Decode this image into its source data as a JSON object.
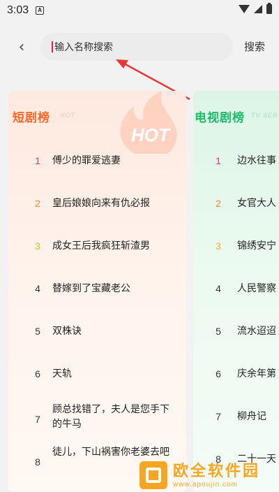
{
  "status_bar": {
    "time": "3:03",
    "notification_icon": "A"
  },
  "header": {
    "back_icon": "chevron-left-icon",
    "back_glyph": "‹",
    "search_placeholder": "输入名称搜索",
    "search_label": "搜索"
  },
  "colors": {
    "short_accent": "#ff6a2a",
    "tv_accent": "#1ebc6a",
    "rank_top1": "#e8307a",
    "rank_top2": "#f08a24",
    "rank_top3": "#f0b424",
    "rank_default": "#333333",
    "arrow": "#e53935"
  },
  "short_card": {
    "title": "短剧榜",
    "subtitle": "HOT",
    "badge_text": "HOT",
    "items": [
      {
        "rank": "1",
        "title": "傅少的罪爱逃妻"
      },
      {
        "rank": "2",
        "title": "皇后娘娘向来有仇必报"
      },
      {
        "rank": "3",
        "title": "成女王后我疯狂斩渣男"
      },
      {
        "rank": "4",
        "title": "替嫁到了宝藏老公"
      },
      {
        "rank": "5",
        "title": "双株诀"
      },
      {
        "rank": "6",
        "title": "天轨"
      },
      {
        "rank": "7",
        "title": "顾总找错了，夫人是您手下的牛马"
      },
      {
        "rank": "8",
        "title": "徒儿，下山祸害你老婆去吧"
      }
    ]
  },
  "tv_card": {
    "title": "电视剧榜",
    "subtitle": "TV SER",
    "items": [
      {
        "rank": "1",
        "title": "边水往事"
      },
      {
        "rank": "2",
        "title": "女官大人"
      },
      {
        "rank": "3",
        "title": "锦绣安宁"
      },
      {
        "rank": "4",
        "title": "人民警察"
      },
      {
        "rank": "5",
        "title": "流水迢迢"
      },
      {
        "rank": "6",
        "title": "庆余年第"
      },
      {
        "rank": "7",
        "title": "柳舟记"
      },
      {
        "rank": "8",
        "title": "二十一天"
      }
    ]
  },
  "watermark": {
    "main": "欧全软件园",
    "url": "www.apoujin.com"
  }
}
